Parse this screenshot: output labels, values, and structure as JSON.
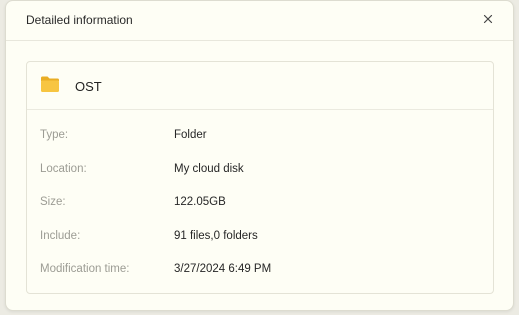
{
  "dialog": {
    "title": "Detailed information",
    "close_icon": "close-icon"
  },
  "item": {
    "icon": "folder-icon",
    "icon_color": "#f5c23d",
    "name": "OST"
  },
  "details": [
    {
      "label": "Type:",
      "value": "Folder"
    },
    {
      "label": "Location:",
      "value": "My cloud disk"
    },
    {
      "label": "Size:",
      "value": "122.05GB"
    },
    {
      "label": "Include:",
      "value": "91 files,0 folders"
    },
    {
      "label": "Modification time:",
      "value": "3/27/2024 6:49 PM"
    }
  ]
}
